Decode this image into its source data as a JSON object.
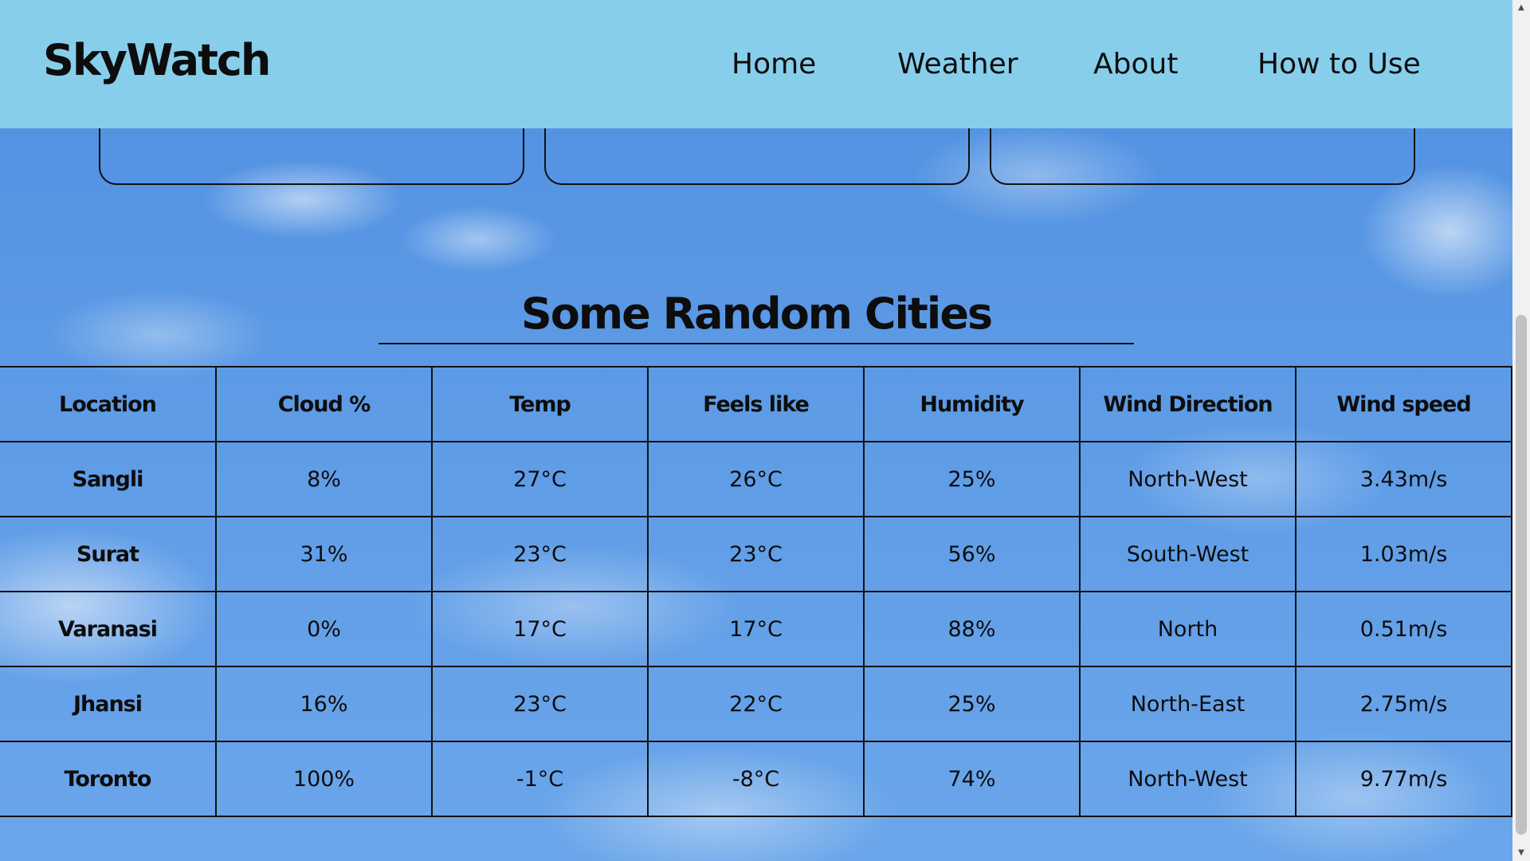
{
  "navbar": {
    "brand": "SkyWatch",
    "links": [
      "Home",
      "Weather",
      "About",
      "How to Use"
    ]
  },
  "section": {
    "title": "Some Random Cities"
  },
  "table": {
    "headers": [
      "Location",
      "Cloud %",
      "Temp",
      "Feels like",
      "Humidity",
      "Wind Direction",
      "Wind speed"
    ],
    "rows": [
      [
        "Sangli",
        "8%",
        "27°C",
        "26°C",
        "25%",
        "North-West",
        "3.43m/s"
      ],
      [
        "Surat",
        "31%",
        "23°C",
        "23°C",
        "56%",
        "South-West",
        "1.03m/s"
      ],
      [
        "Varanasi",
        "0%",
        "17°C",
        "17°C",
        "88%",
        "North",
        "0.51m/s"
      ],
      [
        "Jhansi",
        "16%",
        "23°C",
        "22°C",
        "25%",
        "North-East",
        "2.75m/s"
      ],
      [
        "Toronto",
        "100%",
        "-1°C",
        "-8°C",
        "74%",
        "North-West",
        "9.77m/s"
      ]
    ]
  },
  "scrollbar": {
    "up_icon": "triangle-up-icon",
    "down_icon": "triangle-down-icon"
  },
  "colors": {
    "navbar_bg": "#87ceeb",
    "text": "#0d0d0d",
    "sky": "#5b9be6"
  }
}
